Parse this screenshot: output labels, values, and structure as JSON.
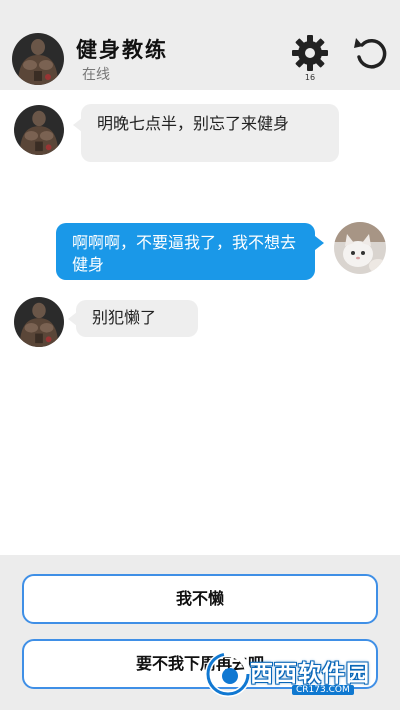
{
  "header": {
    "title": "健身教练",
    "status": "在线",
    "settings_count": "16",
    "avatar_icon": "coach-avatar-icon",
    "settings_icon": "gear-icon",
    "refresh_icon": "refresh-icon"
  },
  "messages": [
    {
      "side": "in",
      "text": "明晚七点半，别忘了来健身",
      "avatar_icon": "coach-avatar-icon"
    },
    {
      "side": "out",
      "text": "啊啊啊，不要逼我了，我不想去健身",
      "avatar_icon": "cat-avatar-icon"
    },
    {
      "side": "in",
      "text": "别犯懒了",
      "avatar_icon": "coach-avatar-icon"
    }
  ],
  "options": [
    {
      "label": "我不懒"
    },
    {
      "label": "要不我下周再去吧"
    }
  ],
  "watermark": {
    "brand": "西西软件园",
    "domain": "CR173.COM"
  },
  "colors": {
    "header_bg": "#ededed",
    "incoming_bubble": "#eeeeee",
    "outgoing_bubble": "#1a98e8",
    "option_border": "#3f8fe6",
    "options_bg": "#ececec"
  }
}
